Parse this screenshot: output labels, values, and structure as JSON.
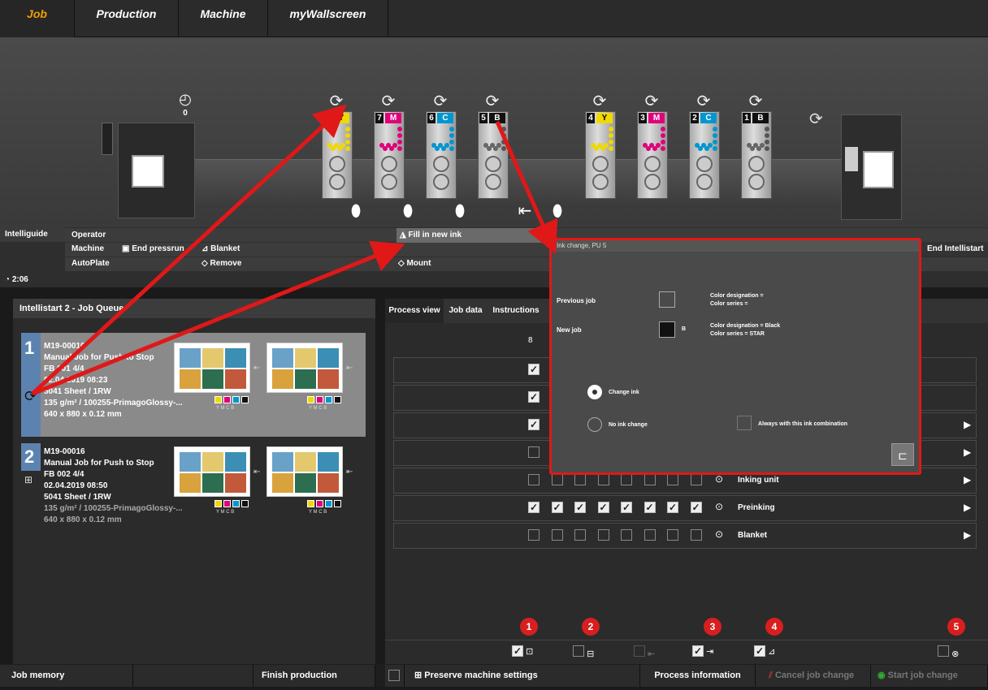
{
  "tabs": [
    "Job",
    "Production",
    "Machine",
    "myWallscreen"
  ],
  "machine": {
    "counter_value": "0",
    "units": [
      {
        "num": "",
        "color": "Y",
        "hex": "#f0d800",
        "text": "#000"
      },
      {
        "num": "7",
        "color": "M",
        "hex": "#e0007a",
        "text": "#fff"
      },
      {
        "num": "6",
        "color": "C",
        "hex": "#0096d0",
        "text": "#fff"
      },
      {
        "num": "5",
        "color": "B",
        "hex": "#111111",
        "text": "#fff"
      },
      {
        "num": "4",
        "color": "Y",
        "hex": "#f0d800",
        "text": "#000"
      },
      {
        "num": "3",
        "color": "M",
        "hex": "#e0007a",
        "text": "#fff"
      },
      {
        "num": "2",
        "color": "C",
        "hex": "#0096d0",
        "text": "#fff"
      },
      {
        "num": "1",
        "color": "B",
        "hex": "#111111",
        "text": "#fff"
      }
    ]
  },
  "intelliguide": {
    "title": "Intelliguide",
    "timer": "2:06",
    "rows": [
      "Operator",
      "Machine",
      "AutoPlate"
    ],
    "end_pressrun": "End pressrun",
    "blanket": "Blanket",
    "remove": "Remove",
    "fill_ink": "Fill in new ink",
    "mount": "Mount",
    "end_intellistart": "End Intellistart"
  },
  "queue": {
    "title": "Intellistart 2 - Job Queue",
    "jobs": [
      {
        "n": "1",
        "id": "M19-00016",
        "name": "Manual Job for Push to Stop",
        "fb": "FB 001  4/4",
        "date": "02.04.2019 08:23",
        "sheets": "5041 Sheet / 1RW",
        "paper": "135 g/m² / 100255-PrimagoGlossy-...",
        "size": "640 x 880 x 0.12 mm"
      },
      {
        "n": "2",
        "id": "M19-00016",
        "name": "Manual Job for Push to Stop",
        "fb": "FB 002  4/4",
        "date": "02.04.2019 08:50",
        "sheets": "5041 Sheet / 1RW",
        "paper": "135 g/m² / 100255-PrimagoGlossy-...",
        "size": "640 x 880 x 0.12 mm"
      }
    ],
    "swatch_label": "Y  M  C  B"
  },
  "process": {
    "tabs": [
      "Process view",
      "Job data",
      "Instructions"
    ],
    "col_header": "8",
    "rows": [
      {
        "label": "",
        "checks": [
          true
        ]
      },
      {
        "label": "",
        "checks": [
          true
        ]
      },
      {
        "label": "",
        "checks": [
          true
        ]
      },
      {
        "label": "",
        "checks": [
          false
        ]
      },
      {
        "label": "Inking unit",
        "checks": [
          false,
          false,
          false,
          false,
          false,
          false,
          false,
          false
        ]
      },
      {
        "label": "Preinking",
        "checks": [
          true,
          true,
          true,
          true,
          true,
          true,
          true,
          true
        ]
      },
      {
        "label": "Blanket",
        "checks": [
          false,
          false,
          false,
          false,
          false,
          false,
          false,
          false
        ]
      }
    ]
  },
  "dialog": {
    "title": "Ink change, PU  5",
    "previous_job": "Previous job",
    "new_job": "New job",
    "prev_desig": "Color designation =",
    "prev_series": "Color series =",
    "new_code": "B",
    "new_desig": "Color designation = Black",
    "new_series": "Color series = STAR",
    "opt_change": "Change ink",
    "opt_none": "No ink change",
    "always": "Always with this ink combination"
  },
  "markers": [
    "1",
    "2",
    "3",
    "4",
    "5"
  ],
  "bottom": {
    "job_memory": "Job memory",
    "finish": "Finish production",
    "preserve": "Preserve machine settings",
    "process_info": "Process information",
    "cancel": "Cancel job change",
    "start": "Start job change"
  }
}
